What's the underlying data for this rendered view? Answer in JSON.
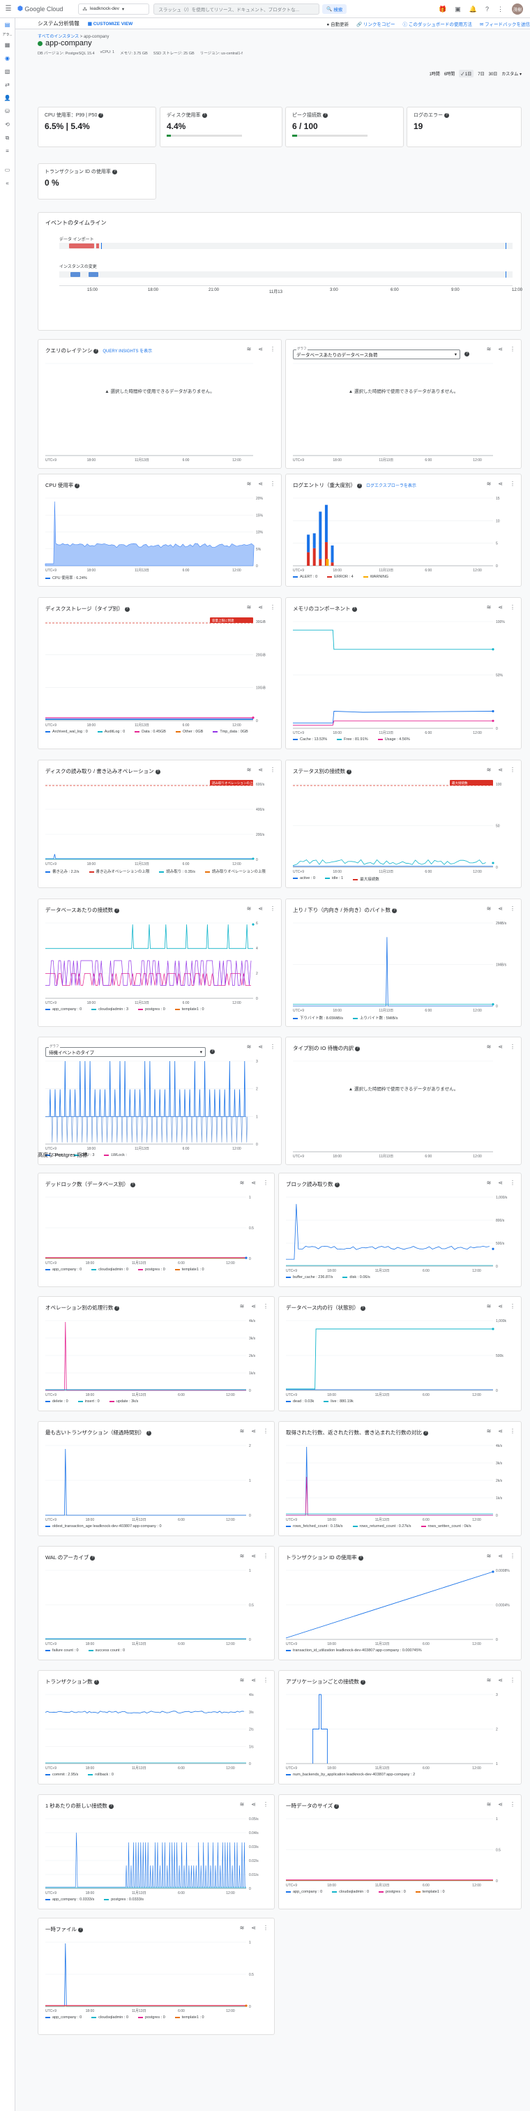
{
  "header": {
    "product": "Google Cloud",
    "project": "leadknock-dev",
    "search_placeholder": "スラッシュ（/）を使用してリソース、ドキュメント、プロダクトな...",
    "search_button": "検索",
    "user_initials": "茂樹"
  },
  "rail": {
    "label": "アラ..."
  },
  "subbar": {
    "title": "システム分析情報",
    "customize": "CUSTOMIZE VIEW",
    "auto_refresh": "自動更新",
    "copy_link": "リンクをコピー",
    "dash_usage": "このダッシュボードの使用方法",
    "feedback": "フィードバックを送信"
  },
  "breadcrumb": {
    "root": "すべてのインスタンス",
    "sep": ">",
    "current": "app-company"
  },
  "instance": {
    "name": "app-company",
    "db_version": "DB バージョン: PostgreSQL 15.4",
    "vcpu": "vCPU: 1",
    "memory": "メモリ: 3.75 GB",
    "ssd": "SSD ストレージ: 25 GB",
    "region": "リージョン: us-central1-f"
  },
  "time_range": {
    "options": [
      "1時間",
      "6時間",
      "1日",
      "7日",
      "30日",
      "カスタム"
    ],
    "selected": "1日"
  },
  "kpis": [
    {
      "label": "CPU 使用率：P99 | P50",
      "value": "6.5% | 5.4%",
      "bar": null
    },
    {
      "label": "ディスク使用率",
      "value": "4.4%",
      "bar": 0.044
    },
    {
      "label": "ピーク接続数",
      "value": "6 / 100",
      "bar": 0.06
    },
    {
      "label": "ログのエラー",
      "value": "19",
      "bar": null
    },
    {
      "label": "トランザクション ID の使用率",
      "value": "0 %",
      "bar": null
    }
  ],
  "timeline": {
    "title": "イベントのタイムライン",
    "row1": "データ インポート",
    "row2": "インスタンスの変更",
    "ticks": [
      "15:00",
      "18:00",
      "21:00",
      "11月13",
      "3:00",
      "6:00",
      "9:00",
      "12:00"
    ]
  },
  "xticks": [
    "UTC+9",
    "18:00",
    "11月13日",
    "6:00",
    "12:00"
  ],
  "nodata_msg": "選択した時間枠で使用できるデータがありません。",
  "qi_link": "QUERY INSIGHTS を表示",
  "logs_link": "ログエクスプローラを表示",
  "section_title": "高度な Postgres 指標",
  "charts": [
    {
      "title": "クエリのレイテンシ",
      "ylab": []
    },
    {
      "title": "",
      "select_label": "グラフ",
      "select_value": "データベースあたりのデータベース負荷",
      "ylab": []
    },
    {
      "title": "CPU 使用率",
      "ylab": [
        "20%",
        "15%",
        "10%",
        "5%",
        "0"
      ],
      "legend": [
        {
          "c": "#1a73e8",
          "t": "CPU 使用率 : 6.24%"
        }
      ]
    },
    {
      "title": "ログエントリ（重大度別）",
      "ylab": [
        "15",
        "10",
        "5",
        "0"
      ],
      "legend": [
        {
          "c": "#1a73e8",
          "t": "ALERT : 0"
        },
        {
          "c": "#d93025",
          "t": "ERROR : 4"
        },
        {
          "c": "#f9ab00",
          "t": "WARNING"
        }
      ]
    },
    {
      "title": "ディスクストレージ（タイプ別）",
      "ylab": [
        "30GiB",
        "20GiB",
        "10GiB",
        "0"
      ],
      "badge": "容量上限に到達",
      "legend": [
        {
          "c": "#1a73e8",
          "t": "Archived_wal_log : 0"
        },
        {
          "c": "#12b5cb",
          "t": "AuditLog : 0"
        },
        {
          "c": "#e52592",
          "t": "Data : 0.45GB"
        },
        {
          "c": "#e8710a",
          "t": "Other : 0GB"
        },
        {
          "c": "#9334e6",
          "t": "Tmp_data : 0GB"
        }
      ]
    },
    {
      "title": "メモリのコンポーネント",
      "ylab": [
        "100%",
        "50%",
        "0"
      ],
      "legend": [
        {
          "c": "#1a73e8",
          "t": "Cache : 13.53%"
        },
        {
          "c": "#12b5cb",
          "t": "Free : 81.91%"
        },
        {
          "c": "#e52592",
          "t": "Usage : 4.56%"
        }
      ]
    },
    {
      "title": "ディスクの読み取り / 書き込みオペレーション",
      "ylab": [
        "600/s",
        "400/s",
        "200/s",
        "0"
      ],
      "badge": "読み取りオペレーションの上限",
      "legend": [
        {
          "c": "#1a73e8",
          "t": "書き込み : 2.2/s"
        },
        {
          "c": "#d93025",
          "t": "書き込みオペレーションの上限"
        },
        {
          "c": "#12b5cb",
          "t": "読み取り : 0.35/s"
        },
        {
          "c": "#e8710a",
          "t": "読み取りオペレーションの上限"
        }
      ]
    },
    {
      "title": "ステータス別の接続数",
      "ylab": [
        "100",
        "50",
        "0"
      ],
      "badge": "最大接続数",
      "legend": [
        {
          "c": "#1a73e8",
          "t": "active : 0"
        },
        {
          "c": "#12b5cb",
          "t": "idle : 1"
        },
        {
          "c": "#d93025",
          "t": "最大接続数"
        }
      ]
    },
    {
      "title": "データベースあたりの接続数",
      "ylab": [
        "6",
        "4",
        "2",
        "0"
      ],
      "legend": [
        {
          "c": "#1a73e8",
          "t": "app_company : 0"
        },
        {
          "c": "#12b5cb",
          "t": "cloudsqladmin : 3"
        },
        {
          "c": "#e52592",
          "t": "postgres : 0"
        },
        {
          "c": "#e8710a",
          "t": "template1 : 0"
        }
      ]
    },
    {
      "title": "上り / 下り（内向き / 外向き）のバイト数",
      "ylab": [
        "2MiB/s",
        "1MiB/s",
        "0"
      ],
      "legend": [
        {
          "c": "#1a73e8",
          "t": "下りバイト数 : 8.65MiB/s"
        },
        {
          "c": "#12b5cb",
          "t": "上りバイト数 : 5MiB/s"
        }
      ]
    },
    {
      "title": "",
      "select_label": "グラフ",
      "select_value": "待機イベントのタイプ",
      "ylab": [
        "3",
        "2",
        "1",
        "0"
      ],
      "legend": [
        {
          "c": "#1a73e8",
          "t": "Client :"
        },
        {
          "c": "#12b5cb",
          "t": "CPU : 3"
        },
        {
          "c": "#e52592",
          "t": "LWLock :"
        }
      ]
    },
    {
      "title": "タイプ別の IO 待機の内訳",
      "ylab": []
    },
    {
      "title": "デッドロック数（データベース別）",
      "ylab": [
        "1",
        "0.5",
        "0"
      ],
      "legend": [
        {
          "c": "#1a73e8",
          "t": "app_company : 0"
        },
        {
          "c": "#12b5cb",
          "t": "cloudsqladmin : 0"
        },
        {
          "c": "#e52592",
          "t": "postgres : 0"
        },
        {
          "c": "#e8710a",
          "t": "template1 : 0"
        }
      ]
    },
    {
      "title": "ブロック読み取り数",
      "ylab": [
        "1,000/s",
        "800/s",
        "500/s",
        "0"
      ],
      "legend": [
        {
          "c": "#1a73e8",
          "t": "buffer_cache : 236.87/s"
        },
        {
          "c": "#12b5cb",
          "t": "disk : 0.06/s"
        }
      ]
    },
    {
      "title": "オペレーション別の処理行数",
      "ylab": [
        "4k/s",
        "3k/s",
        "2k/s",
        "1k/s",
        "0"
      ],
      "legend": [
        {
          "c": "#1a73e8",
          "t": "delete : 0"
        },
        {
          "c": "#12b5cb",
          "t": "insert : 0"
        },
        {
          "c": "#e52592",
          "t": "update : 3k/s"
        }
      ]
    },
    {
      "title": "データベース内の行（状態別）",
      "ylab": [
        "1,000k",
        "500k",
        "0"
      ],
      "legend": [
        {
          "c": "#1a73e8",
          "t": "dead : 0.03k"
        },
        {
          "c": "#12b5cb",
          "t": "live : 880.19k"
        }
      ]
    },
    {
      "title": "最も古いトランザクション（経過時間別）",
      "ylab": [
        "2",
        "1",
        "0"
      ],
      "legend": [
        {
          "c": "#1a73e8",
          "t": "oldest_transaction_age leadknock-dev-403807:app-company : 0"
        }
      ]
    },
    {
      "title": "取得された行数、返された行数、書き込まれた行数の対比",
      "ylab": [
        "4k/s",
        "3k/s",
        "2k/s",
        "1k/s",
        "0"
      ],
      "legend": [
        {
          "c": "#1a73e8",
          "t": "rows_fetched_count : 0.15k/s"
        },
        {
          "c": "#12b5cb",
          "t": "rows_returned_count : 0.27k/s"
        },
        {
          "c": "#e52592",
          "t": "rows_written_count : 0k/s"
        }
      ]
    },
    {
      "title": "WAL のアーカイブ",
      "ylab": [
        "1",
        "0.5",
        "0"
      ],
      "legend": [
        {
          "c": "#1a73e8",
          "t": "failure count : 0"
        },
        {
          "c": "#12b5cb",
          "t": "success count : 0"
        }
      ]
    },
    {
      "title": "トランザクション ID の使用率",
      "ylab": [
        "0.0008%",
        "0.0004%",
        "0"
      ],
      "legend": [
        {
          "c": "#1a73e8",
          "t": "transaction_id_utilization leadknock-dev-403807:app-company : 0.000745%"
        }
      ]
    },
    {
      "title": "トランザクション数",
      "ylab": [
        "4/s",
        "3/s",
        "2/s",
        "1/s",
        "0"
      ],
      "legend": [
        {
          "c": "#1a73e8",
          "t": "commit : 2.95/s"
        },
        {
          "c": "#12b5cb",
          "t": "rollback : 0"
        }
      ]
    },
    {
      "title": "アプリケーションごとの接続数",
      "ylab": [
        "3",
        "2",
        "1"
      ],
      "legend": [
        {
          "c": "#1a73e8",
          "t": "num_backends_by_application leadknock-dev-403807:app-company : 2"
        }
      ]
    },
    {
      "title": "1 秒あたりの新しい接続数",
      "ylab": [
        "0.05/s",
        "0.04/s",
        "0.03/s",
        "0.02/s",
        "0.01/s",
        "0"
      ],
      "legend": [
        {
          "c": "#1a73e8",
          "t": "app_company : 0.0333/s"
        },
        {
          "c": "#12b5cb",
          "t": "postgres : 0.0333/s"
        }
      ]
    },
    {
      "title": "一時データのサイズ",
      "ylab": [
        "1",
        "0.5",
        "0"
      ],
      "legend": [
        {
          "c": "#1a73e8",
          "t": "app_company : 0"
        },
        {
          "c": "#12b5cb",
          "t": "cloudsqladmin : 0"
        },
        {
          "c": "#e52592",
          "t": "postgres : 0"
        },
        {
          "c": "#e8710a",
          "t": "template1 : 0"
        }
      ]
    },
    {
      "title": "一時ファイル",
      "ylab": [
        "1",
        "0.5",
        "0"
      ],
      "legend": [
        {
          "c": "#1a73e8",
          "t": "app_company : 0"
        },
        {
          "c": "#12b5cb",
          "t": "cloudsqladmin : 0"
        },
        {
          "c": "#e52592",
          "t": "postgres : 0"
        },
        {
          "c": "#e8710a",
          "t": "template1 : 0"
        }
      ]
    }
  ]
}
